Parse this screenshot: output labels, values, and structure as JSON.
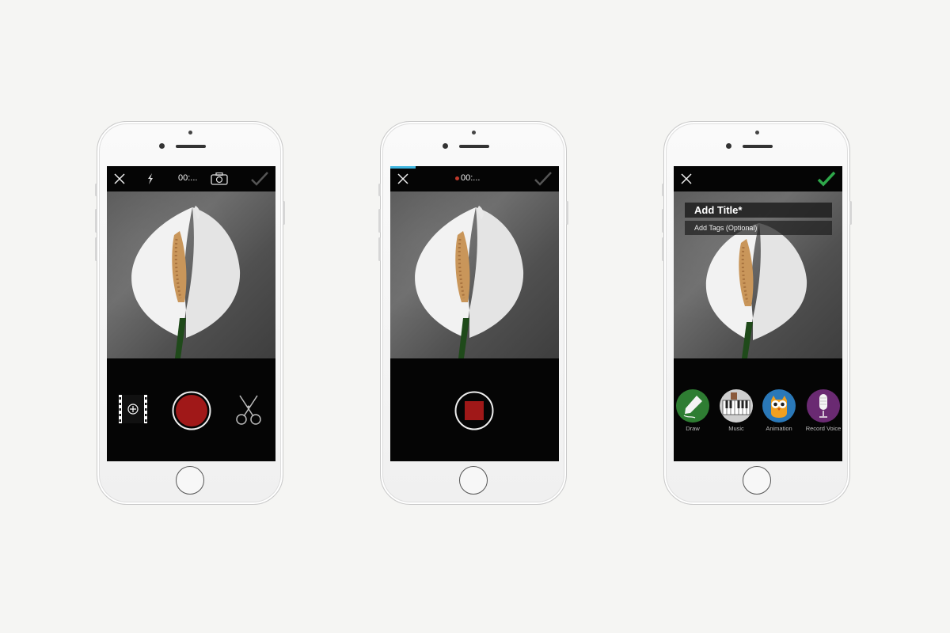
{
  "screens": [
    {
      "timer": "00:...",
      "icons": [
        "close-icon",
        "flash-icon",
        "camera-switch-icon",
        "checkmark-icon",
        "add-media-icon",
        "record-icon",
        "scissors-icon"
      ]
    },
    {
      "timer": "00:...",
      "progress_percent": 15,
      "icons": [
        "close-icon",
        "checkmark-icon",
        "stop-icon"
      ]
    },
    {
      "title_placeholder": "Add Title*",
      "tags_placeholder": "Add Tags (Optional)",
      "tools": [
        {
          "label": "Draw",
          "icon": "pencil-icon",
          "color": "#2e7d32"
        },
        {
          "label": "Music",
          "icon": "piano-icon",
          "color": "#cfcfcf"
        },
        {
          "label": "Animation",
          "icon": "owl-icon",
          "color": "#2a78b8"
        },
        {
          "label": "Record Voice",
          "icon": "microphone-icon",
          "color": "#6a2a72"
        }
      ]
    }
  ],
  "colors": {
    "record_red": "#a01818",
    "accent_green": "#2ea84a",
    "progress_blue": "#3fb6e0"
  }
}
